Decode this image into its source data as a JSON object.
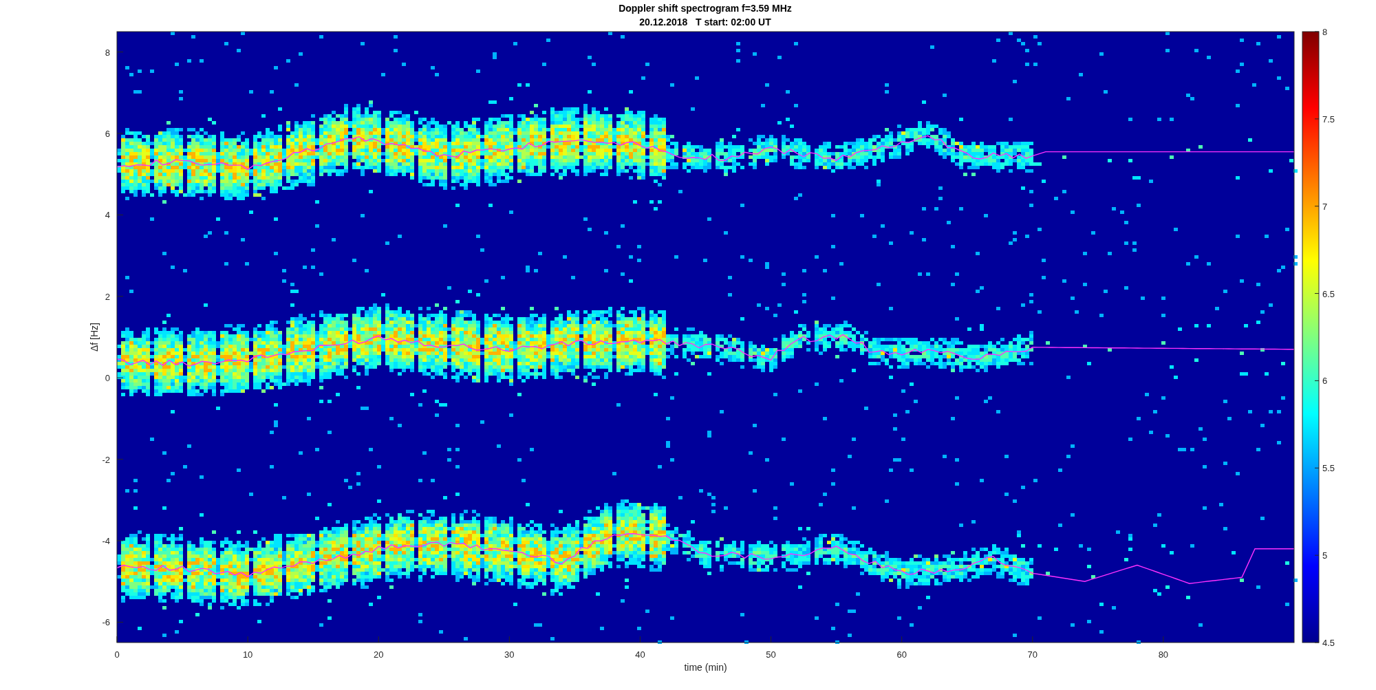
{
  "figure": {
    "title": "Doppler shift spectrogram f=3.59 MHz",
    "subtitle": "20.12.2018   T start: 02:00 UT",
    "xlabel": "time (min)",
    "ylabel": "Δf [Hz]",
    "xticks": [
      "0",
      "10",
      "20",
      "30",
      "40",
      "50",
      "60",
      "70",
      "80"
    ],
    "yticks": [
      "8",
      "6",
      "4",
      "2",
      "0",
      "-2",
      "-4",
      "-6"
    ],
    "colorbar": {
      "ticks": [
        "8",
        "7.5",
        "7",
        "6.5",
        "6",
        "5.5",
        "5",
        "4.5"
      ]
    }
  }
}
